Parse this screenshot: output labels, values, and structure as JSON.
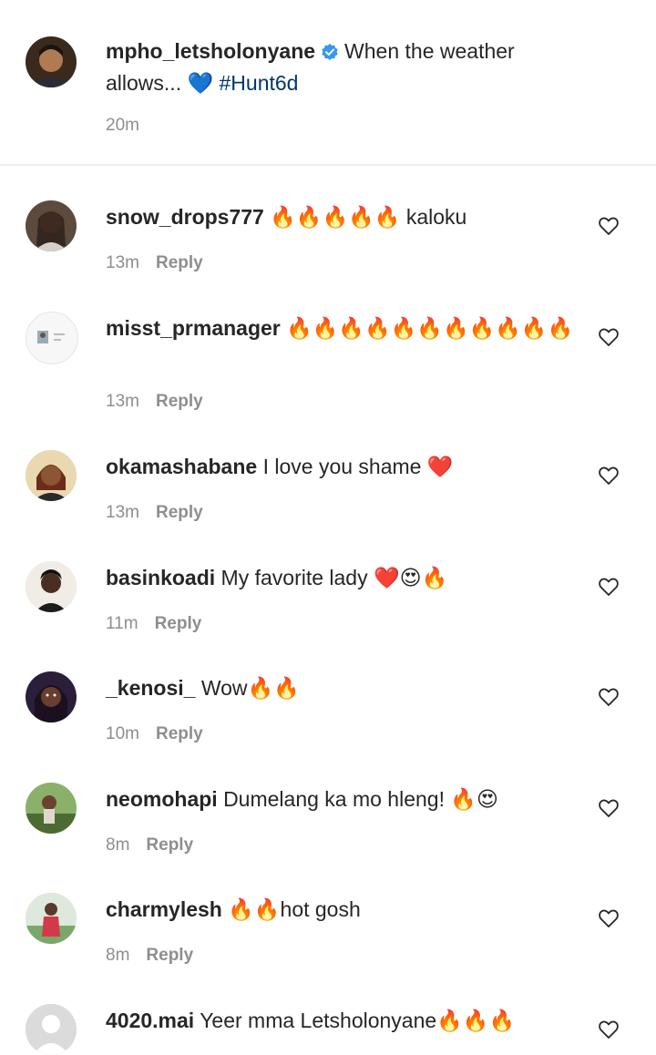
{
  "caption": {
    "username": "mpho_letsholonyane",
    "text": "When the weather allows... 💙 ",
    "hashtag": "#Hunt6d",
    "time": "20m"
  },
  "reply_label": "Reply",
  "comments": [
    {
      "username": "snow_drops777",
      "text": "🔥🔥🔥🔥🔥 kaloku",
      "time": "13m"
    },
    {
      "username": "misst_prmanager",
      "text": "🔥🔥🔥🔥🔥🔥🔥🔥🔥🔥🔥",
      "time": "13m"
    },
    {
      "username": "okamashabane",
      "text": "I love you shame ❤️",
      "time": "13m"
    },
    {
      "username": "basinkoadi",
      "text": "My favorite lady ❤️😍🔥",
      "time": "11m"
    },
    {
      "username": "_kenosi_",
      "text": "Wow🔥🔥",
      "time": "10m"
    },
    {
      "username": "neomohapi",
      "text": "Dumelang ka mo hleng! 🔥😍",
      "time": "8m"
    },
    {
      "username": "charmylesh",
      "text": "🔥🔥hot gosh",
      "time": "8m"
    },
    {
      "username": "4020.mai",
      "text": "Yeer mma Letsholonyane🔥🔥🔥",
      "time": ""
    }
  ],
  "colors": {
    "text": "#262626",
    "meta": "#8e8e8e",
    "hashtag": "#00376b",
    "verified": "#3897f0"
  }
}
